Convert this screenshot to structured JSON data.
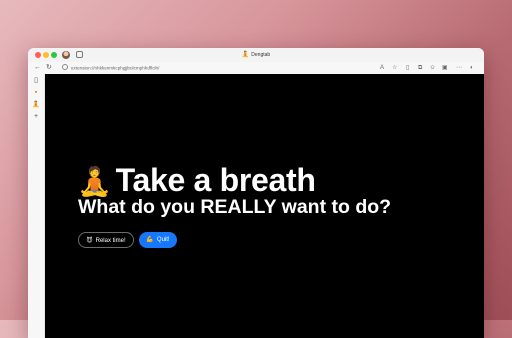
{
  "browser": {
    "tab_title": "Dengtab",
    "tab_favicon": "🧘",
    "address": "extension://nhkkenmkcphgjjbolcmphhdflcih/"
  },
  "sidebar": {
    "items": [
      {
        "icon": "sidebar-toggle-icon",
        "glyph": "▯"
      },
      {
        "icon": "favicon-orange",
        "glyph": "▪"
      },
      {
        "icon": "meditation-tab-icon",
        "glyph": "🧘"
      },
      {
        "icon": "plus-icon",
        "glyph": "+"
      }
    ]
  },
  "main": {
    "headline_emoji": "🧘",
    "headline": "Take a breath",
    "subline": "What do you REALLY want to do?",
    "relax_button": {
      "icon": "😈",
      "label": "Relax time!"
    },
    "quit_button": {
      "icon": "💪",
      "label": "Quit!"
    }
  },
  "colors": {
    "quit_button": "#1677ff",
    "content_background": "#000000"
  }
}
